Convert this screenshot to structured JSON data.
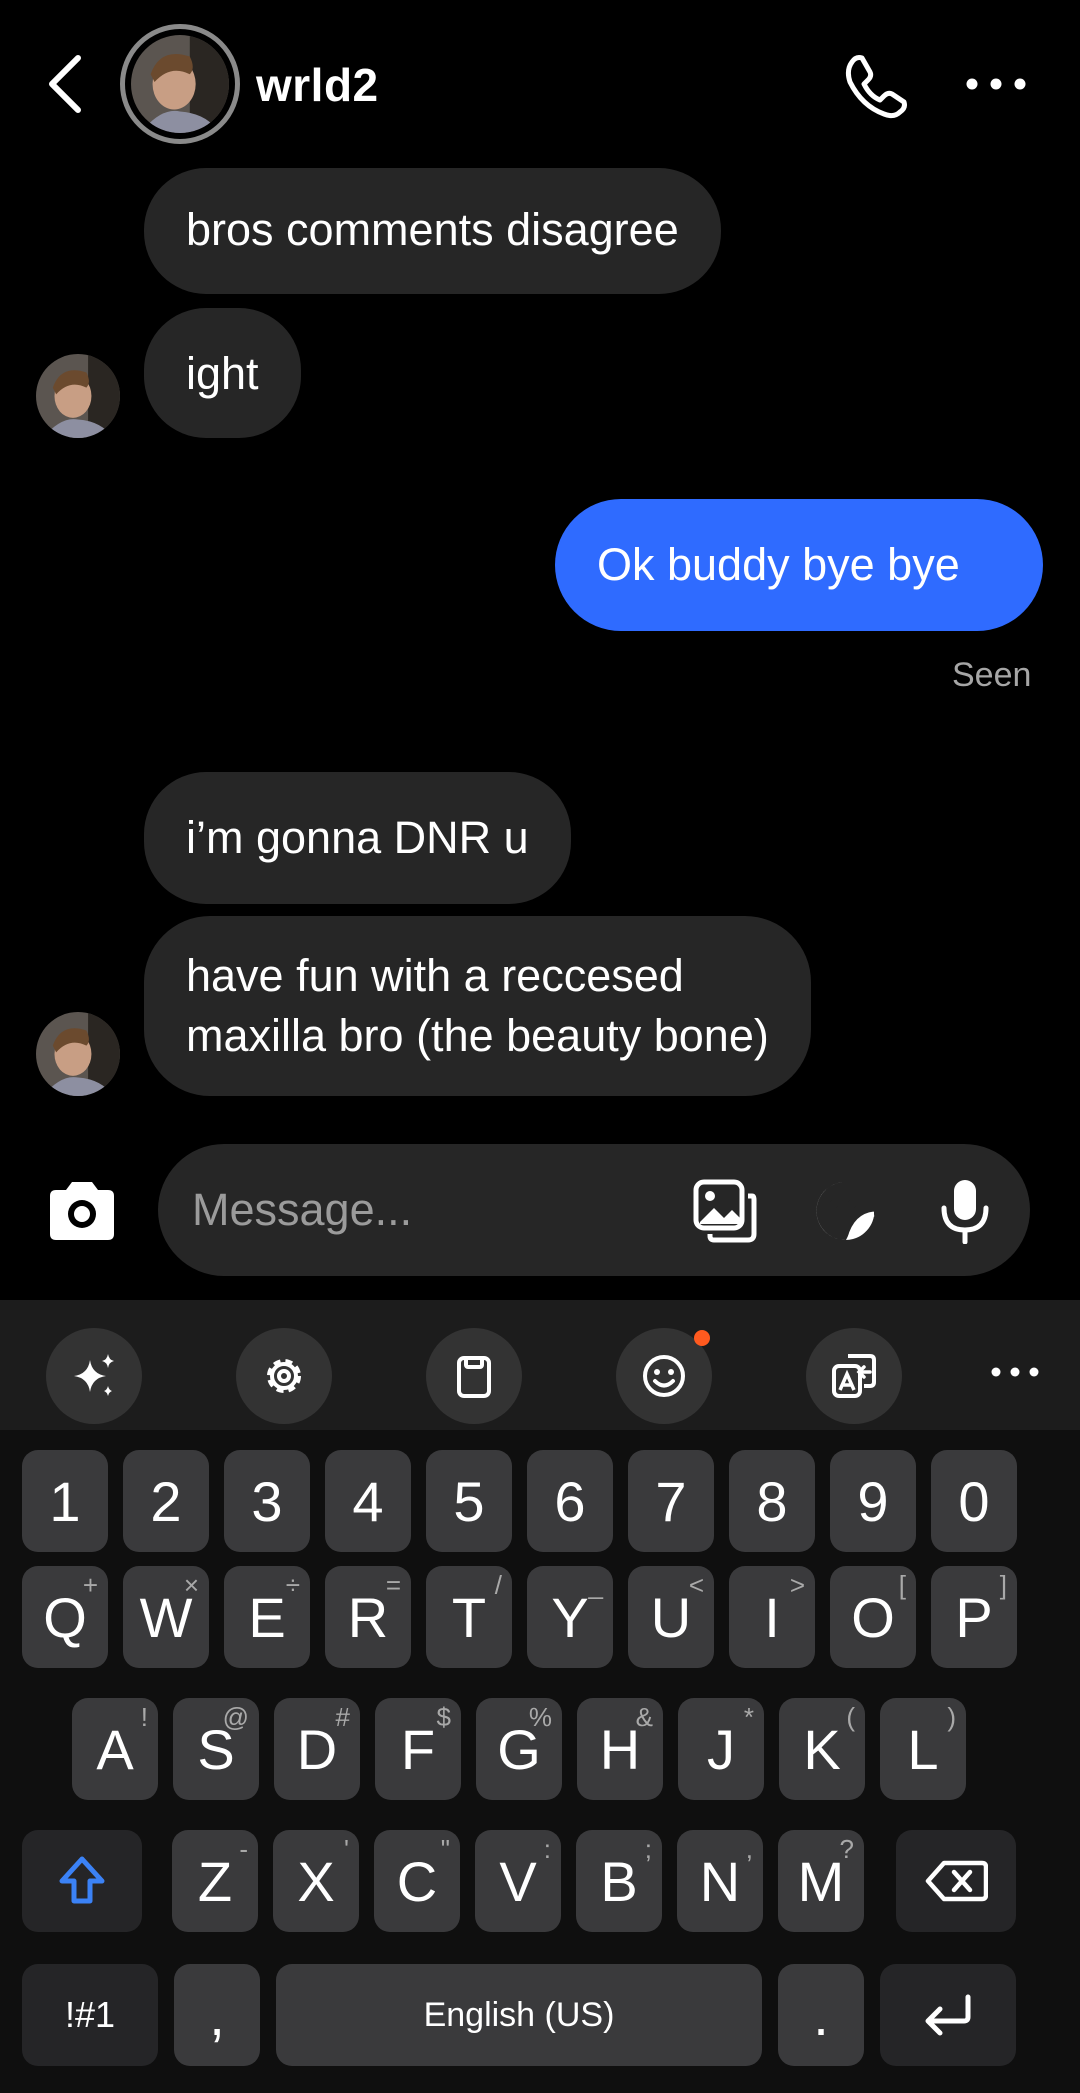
{
  "header": {
    "contact_name": "wrld2"
  },
  "messages": [
    {
      "direction": "incoming",
      "text": "bros comments disagree"
    },
    {
      "direction": "incoming",
      "text": "ight"
    },
    {
      "direction": "outgoing",
      "text": "Ok buddy bye bye"
    },
    {
      "direction": "incoming",
      "text": "i’m gonna DNR u"
    },
    {
      "direction": "incoming",
      "lines": [
        "have fun with a reccesed",
        "maxilla bro (the beauty bone)"
      ]
    }
  ],
  "status": {
    "seen_label": "Seen"
  },
  "composer": {
    "placeholder": "Message..."
  },
  "keyboard": {
    "toolbar": [
      "sparkle-icon",
      "gear-icon",
      "clipboard-icon",
      "emoji-icon",
      "translate-icon",
      "more-icon"
    ],
    "number_row": [
      "1",
      "2",
      "3",
      "4",
      "5",
      "6",
      "7",
      "8",
      "9",
      "0"
    ],
    "row1": [
      {
        "key": "Q",
        "hint": "+"
      },
      {
        "key": "W",
        "hint": "×"
      },
      {
        "key": "E",
        "hint": "÷"
      },
      {
        "key": "R",
        "hint": "="
      },
      {
        "key": "T",
        "hint": "/"
      },
      {
        "key": "Y",
        "hint": "_"
      },
      {
        "key": "U",
        "hint": "<"
      },
      {
        "key": "I",
        "hint": ">"
      },
      {
        "key": "O",
        "hint": "["
      },
      {
        "key": "P",
        "hint": "]"
      }
    ],
    "row2": [
      {
        "key": "A",
        "hint": "!"
      },
      {
        "key": "S",
        "hint": "@"
      },
      {
        "key": "D",
        "hint": "#"
      },
      {
        "key": "F",
        "hint": "$"
      },
      {
        "key": "G",
        "hint": "%"
      },
      {
        "key": "H",
        "hint": "&"
      },
      {
        "key": "J",
        "hint": "*"
      },
      {
        "key": "K",
        "hint": "("
      },
      {
        "key": "L",
        "hint": ")"
      }
    ],
    "row3": [
      {
        "key": "Z",
        "hint": "-"
      },
      {
        "key": "X",
        "hint": "'"
      },
      {
        "key": "C",
        "hint": "\""
      },
      {
        "key": "V",
        "hint": ":"
      },
      {
        "key": "B",
        "hint": ";"
      },
      {
        "key": "N",
        "hint": ","
      },
      {
        "key": "M",
        "hint": "?"
      }
    ],
    "symbols_label": "!#1",
    "comma_label": ",",
    "space_label": "English (US)",
    "period_label": "."
  }
}
